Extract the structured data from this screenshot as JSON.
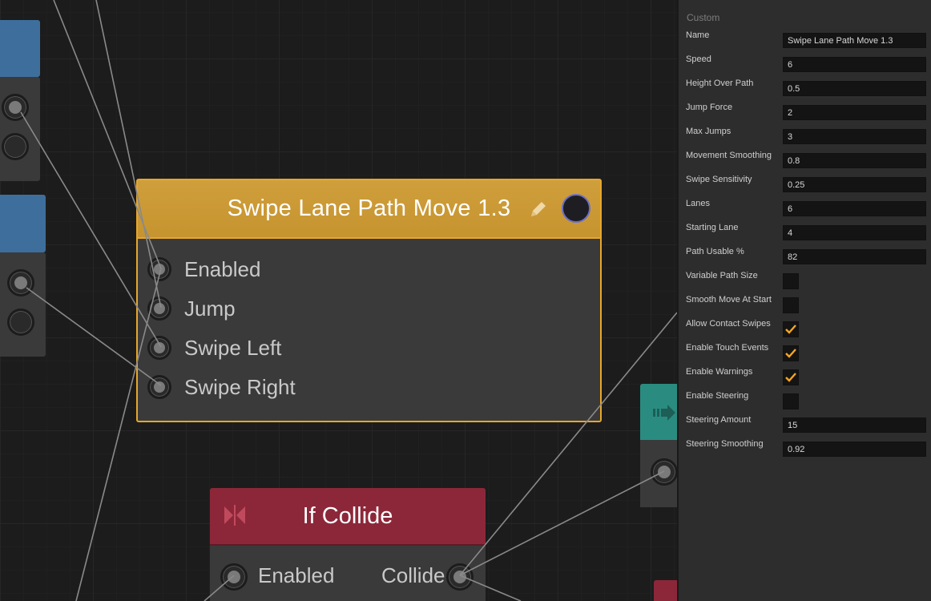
{
  "graph": {
    "main_node": {
      "title": "Swipe Lane Path Move 1.3",
      "inputs": [
        "Enabled",
        "Jump",
        "Swipe Left",
        "Swipe Right"
      ]
    },
    "collide_node": {
      "title": "If Collide",
      "input_label": "Enabled",
      "output_label": "Collide"
    }
  },
  "colors": {
    "main_node_header": "#c9993a",
    "main_node_border": "#e7a72b",
    "collide_header": "#8c2739",
    "teal_header": "#2a8c80",
    "blue_header": "#3e6e9c",
    "check_accent": "#f5a623"
  },
  "inspector": {
    "section": "Custom",
    "properties": [
      {
        "label": "Name",
        "type": "text",
        "value": "Swipe Lane Path Move 1.3"
      },
      {
        "label": "Speed",
        "type": "text",
        "value": "6"
      },
      {
        "label": "Height Over Path",
        "type": "text",
        "value": "0.5"
      },
      {
        "label": "Jump Force",
        "type": "text",
        "value": "2"
      },
      {
        "label": "Max Jumps",
        "type": "text",
        "value": "3"
      },
      {
        "label": "Movement Smoothing",
        "type": "text",
        "value": "0.8"
      },
      {
        "label": "Swipe Sensitivity",
        "type": "text",
        "value": "0.25"
      },
      {
        "label": "Lanes",
        "type": "text",
        "value": "6"
      },
      {
        "label": "Starting Lane",
        "type": "text",
        "value": "4"
      },
      {
        "label": "Path Usable %",
        "type": "text",
        "value": "82"
      },
      {
        "label": "Variable Path Size",
        "type": "check",
        "checked": false
      },
      {
        "label": "Smooth Move At Start",
        "type": "check",
        "checked": false
      },
      {
        "label": "Allow Contact Swipes",
        "type": "check",
        "checked": true
      },
      {
        "label": "Enable Touch Events",
        "type": "check",
        "checked": true
      },
      {
        "label": "Enable Warnings",
        "type": "check",
        "checked": true
      },
      {
        "label": "Enable Steering",
        "type": "check",
        "checked": false
      },
      {
        "label": "Steering Amount",
        "type": "text",
        "value": "15"
      },
      {
        "label": "Steering Smoothing",
        "type": "text",
        "value": "0.92"
      }
    ]
  }
}
